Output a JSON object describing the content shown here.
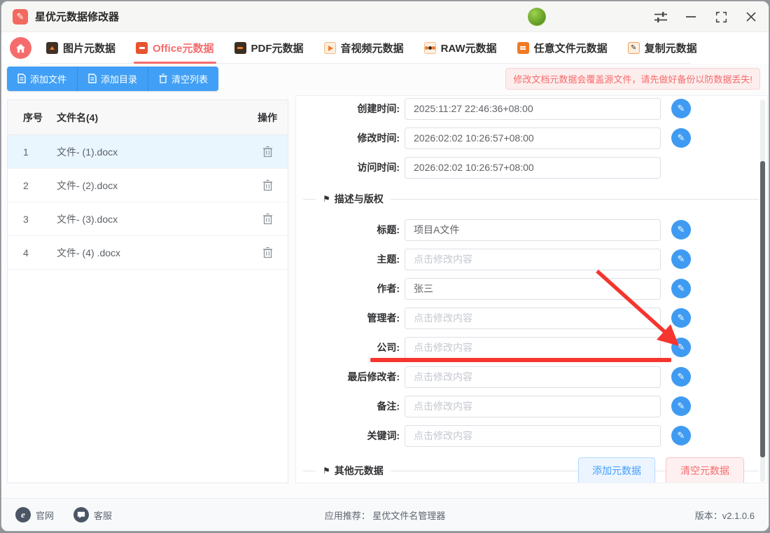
{
  "titlebar": {
    "app_title": "星优元数据修改器"
  },
  "tabs": {
    "items": [
      {
        "label": "图片元数据"
      },
      {
        "label": "Office元数据",
        "active": true
      },
      {
        "label": "PDF元数据"
      },
      {
        "label": "音视频元数据"
      },
      {
        "label": "RAW元数据"
      },
      {
        "label": "任意文件元数据"
      },
      {
        "label": "复制元数据"
      }
    ]
  },
  "toolbar": {
    "add_file": "添加文件",
    "add_folder": "添加目录",
    "clear_list": "清空列表",
    "warning": "修改文档元数据会覆盖源文件，请先做好备份以防数据丢失!"
  },
  "file_list": {
    "headers": {
      "index": "序号",
      "name": "文件名(4)",
      "action": "操作"
    },
    "rows": [
      {
        "index": "1",
        "name": "文件- (1).docx"
      },
      {
        "index": "2",
        "name": "文件- (2).docx"
      },
      {
        "index": "3",
        "name": "文件- (3).docx"
      },
      {
        "index": "4",
        "name": "文件- (4) .docx"
      }
    ]
  },
  "form": {
    "time_rows": [
      {
        "label": "创建时间:",
        "value": "2025:11:27 22:46:36+08:00"
      },
      {
        "label": "修改时间:",
        "value": "2026:02:02 10:26:57+08:00"
      },
      {
        "label": "访问时间:",
        "value": "2026:02:02 10:26:57+08:00"
      }
    ],
    "section_copyright": "描述与版权",
    "fields": [
      {
        "label": "标题:",
        "value": "项目A文件"
      },
      {
        "label": "主题:",
        "placeholder": "点击修改内容"
      },
      {
        "label": "作者:",
        "value": "张三"
      },
      {
        "label": "管理者:",
        "placeholder": "点击修改内容"
      },
      {
        "label": "公司:",
        "placeholder": "点击修改内容"
      },
      {
        "label": "最后修改者:",
        "placeholder": "点击修改内容"
      },
      {
        "label": "备注:",
        "placeholder": "点击修改内容"
      },
      {
        "label": "关键词:",
        "placeholder": "点击修改内容"
      }
    ],
    "section_other": "其他元数据",
    "add_meta_label": "添加元数据",
    "clear_meta_label": "清空元数据"
  },
  "footer": {
    "site": "官网",
    "support": "客服",
    "recommend": "应用推荐： 星优文件名管理器",
    "version": "版本：v2.1.0.6"
  },
  "icons": {
    "edit_glyph": "✎",
    "flag_glyph": "⚑",
    "pencil_glyph": "✎",
    "e_glyph": "e"
  },
  "colors": {
    "accent_red": "#f56c6c",
    "primary_blue": "#41a0f5",
    "annotation_red": "#f5352e"
  }
}
